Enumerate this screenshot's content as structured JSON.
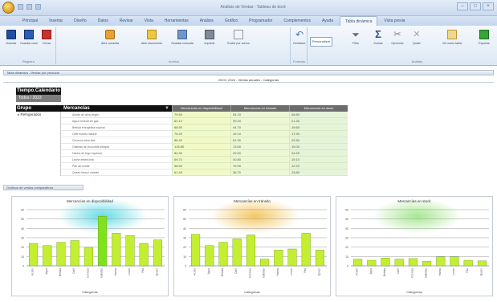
{
  "window": {
    "title": "Análisis de Ventas - Tableau de bord",
    "minimize_glyph": "–",
    "maximize_glyph": "□",
    "close_glyph": "×"
  },
  "ribbon": {
    "tabs": [
      "Principal",
      "Insertar",
      "Diseño",
      "Datos",
      "Revisar",
      "Vista",
      "Herramientas",
      "Análisis",
      "Gráfico",
      "Programador",
      "Complementos",
      "Ayuda",
      "Tabla dinámica",
      "Vista previa"
    ],
    "active_tab_index": 12,
    "groups": [
      {
        "label": "Registro",
        "buttons": [
          "Guardar",
          "Guardar como",
          "Cerrar"
        ]
      },
      {
        "label": "Archivo",
        "buttons": [
          "Abrir consulta",
          "Abrir documento",
          "Guardar consulta",
          "Imprimir",
          "Enviar por correo"
        ]
      },
      {
        "label": "Formato",
        "buttons": [
          "Deshacer"
        ]
      },
      {
        "label": "Análisis",
        "buttons": [
          "Filtro",
          "Sumas",
          "Opciones",
          "Quitar",
          "Ver como tabla",
          "Exportar"
        ]
      }
    ],
    "check_button_label": "Personalizar"
  },
  "pivot_section": {
    "header_label": "Tabla dinámica - Ventas por producto",
    "grand_title": "2023 / 2024 - Ventas anuales - Categorías",
    "tiempo_label": "Tiempo.Calendario",
    "tiempo_value": "Todos / 2023",
    "grupo_label": "Grupo",
    "mercancias_label": "Mercancías",
    "sort_glyph": "▼",
    "group_value": "Refrigerados",
    "group_toggle": "▸",
    "columns": [
      "Mercancías en disponibilidad",
      "Mercancías en tránsito",
      "Mercancías en stock"
    ],
    "rows": [
      {
        "name": "Aceite de oliva virgen",
        "v1": "79.50",
        "v2": "54.20",
        "v3": "48.80"
      },
      {
        "name": "Agua mineral sin gas",
        "v1": "62.10",
        "v2": "39.40",
        "v3": "21.30"
      },
      {
        "name": "Bebida energética tropical",
        "v1": "68.90",
        "v2": "44.70",
        "v3": "19.60"
      },
      {
        "name": "Café molido natural",
        "v1": "76.20",
        "v2": "49.10",
        "v3": "17.90"
      },
      {
        "name": "Cerveza rubia lata",
        "v1": "88.40",
        "v2": "61.30",
        "v3": "22.50"
      },
      {
        "name": "Galletas de chocolate integral",
        "v1": "126.80",
        "v2": "13.60",
        "v3": "15.00"
      },
      {
        "name": "Harina de trigo especial",
        "v1": "84.30",
        "v2": "29.50",
        "v3": "24.20"
      },
      {
        "name": "Leche entera brik",
        "v1": "69.70",
        "v2": "40.80",
        "v3": "19.10"
      },
      {
        "name": "Pan de molde",
        "v1": "58.60",
        "v2": "76.90",
        "v3": "12.20"
      },
      {
        "name": "Queso fresco untable",
        "v1": "61.40",
        "v2": "36.70",
        "v3": "13.80"
      }
    ]
  },
  "charts_section": {
    "header_label": "Gráficos de ventas comparativos",
    "panels": [
      {
        "title": "Mercancías en disponibilidad",
        "xlabel": "Categorías",
        "glow": "#2fd0e0"
      },
      {
        "title": "Mercancías en tránsito",
        "xlabel": "Categorías",
        "glow": "#f2b42a"
      },
      {
        "title": "Mercancías en stock",
        "xlabel": "Categorías",
        "glow": "#88e06a"
      }
    ]
  },
  "colors": {
    "bar_fill": "#c4ee32",
    "bar_highlight": "#7fe31b",
    "bar_stroke": "#6a9a12",
    "green_cell": "#f1f9c9"
  },
  "chart_data": [
    {
      "type": "bar",
      "title": "Mercancías en disponibilidad",
      "xlabel": "Categorías",
      "ylabel": "",
      "categories": [
        "Aceite",
        "Agua",
        "Bebida",
        "Café",
        "Cerveza",
        "Galletas",
        "Harina",
        "Leche",
        "Pan",
        "Queso"
      ],
      "values": [
        40,
        36,
        42,
        45,
        33,
        88,
        58,
        54,
        40,
        46
      ],
      "ylim": [
        0,
        100
      ],
      "yticks": [
        "60",
        "50",
        "40",
        "30",
        "20",
        "10",
        "0"
      ],
      "grid": true,
      "highlight_index": 5
    },
    {
      "type": "bar",
      "title": "Mercancías en tránsito",
      "xlabel": "Categorías",
      "ylabel": "",
      "categories": [
        "Aceite",
        "Agua",
        "Bebida",
        "Café",
        "Cerveza",
        "Galletas",
        "Harina",
        "Leche",
        "Pan",
        "Queso"
      ],
      "values": [
        56,
        36,
        42,
        48,
        55,
        12,
        28,
        30,
        58,
        28
      ],
      "ylim": [
        0,
        100
      ],
      "yticks": [
        "60",
        "50",
        "40",
        "30",
        "20",
        "10",
        "0"
      ],
      "grid": true,
      "highlight_index": -1
    },
    {
      "type": "bar",
      "title": "Mercancías en stock",
      "xlabel": "Categorías",
      "ylabel": "",
      "categories": [
        "Aceite",
        "Agua",
        "Bebida",
        "Café",
        "Cerveza",
        "Galletas",
        "Harina",
        "Leche",
        "Pan",
        "Queso"
      ],
      "values": [
        12,
        10,
        14,
        12,
        13,
        8,
        16,
        16,
        10,
        9
      ],
      "ylim": [
        0,
        100
      ],
      "yticks": [
        "60",
        "50",
        "40",
        "30",
        "20",
        "10",
        "0"
      ],
      "grid": true,
      "highlight_index": -1
    }
  ]
}
